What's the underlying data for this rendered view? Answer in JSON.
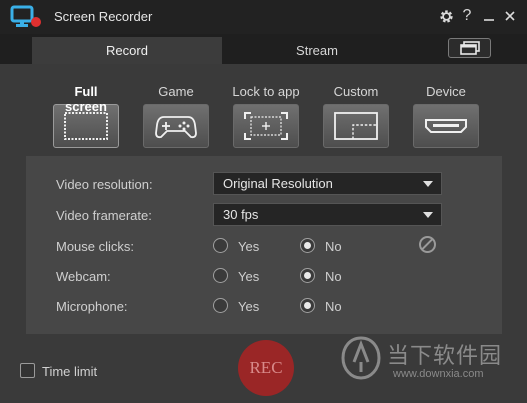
{
  "window": {
    "title": "Screen Recorder",
    "buttons": [
      "gear-icon",
      "help-icon",
      "minimize-icon",
      "close-icon"
    ],
    "help_label": "?"
  },
  "tabs": [
    {
      "label": "Record",
      "active": true
    },
    {
      "label": "Stream",
      "active": false
    }
  ],
  "modes": [
    {
      "label": "Full screen",
      "icon": "full-screen-icon",
      "active": true
    },
    {
      "label": "Game",
      "icon": "gamepad-icon",
      "active": false
    },
    {
      "label": "Lock to app",
      "icon": "lock-to-app-icon",
      "active": false
    },
    {
      "label": "Custom",
      "icon": "custom-region-icon",
      "active": false
    },
    {
      "label": "Device",
      "icon": "hdmi-device-icon",
      "active": false
    }
  ],
  "settings": {
    "video_resolution": {
      "label": "Video resolution:",
      "value": "Original Resolution"
    },
    "video_framerate": {
      "label": "Video framerate:",
      "value": "30 fps"
    },
    "mouse_clicks": {
      "label": "Mouse clicks:",
      "yes": "Yes",
      "no": "No",
      "selected": "No"
    },
    "webcam": {
      "label": "Webcam:",
      "yes": "Yes",
      "no": "No",
      "selected": "No"
    },
    "microphone": {
      "label": "Microphone:",
      "yes": "Yes",
      "no": "No",
      "selected": "No"
    }
  },
  "time_limit": {
    "label": "Time limit",
    "checked": false
  },
  "rec_button": {
    "label": "REC"
  },
  "watermark": {
    "text": "当下软件园",
    "url": "www.downxia.com"
  },
  "colors": {
    "accent": "#2a9fd6",
    "rec": "#9a2626",
    "background": "#3a3a3a"
  }
}
